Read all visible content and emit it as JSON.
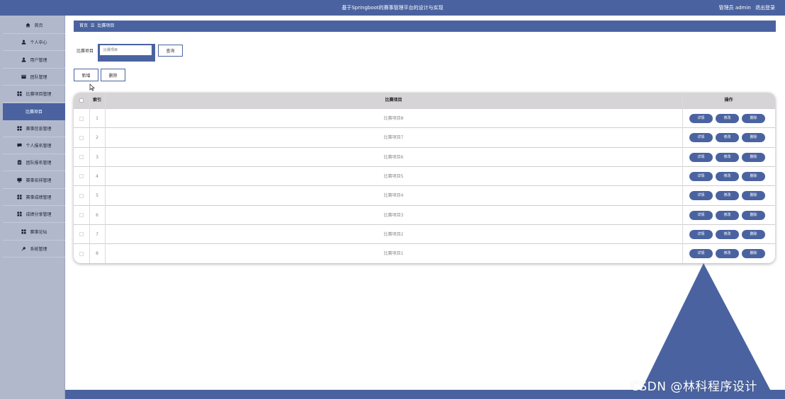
{
  "header": {
    "title": "基于Springboot的赛事管理平台的设计与实现",
    "user_label": "管理员 admin",
    "logout_label": "退出登录"
  },
  "sidebar": {
    "items": [
      {
        "label": "首页",
        "icon": "home-icon"
      },
      {
        "label": "个人中心",
        "icon": "user-icon"
      },
      {
        "label": "用户管理",
        "icon": "user-icon"
      },
      {
        "label": "团队管理",
        "icon": "folder-icon"
      },
      {
        "label": "比赛项目管理",
        "icon": "grid-icon"
      },
      {
        "label": "比赛项目",
        "icon": "",
        "active": true
      },
      {
        "label": "赛事信息管理",
        "icon": "grid-icon"
      },
      {
        "label": "个人报名管理",
        "icon": "comment-icon"
      },
      {
        "label": "团队报名管理",
        "icon": "clipboard-icon"
      },
      {
        "label": "赛事安排管理",
        "icon": "monitor-icon"
      },
      {
        "label": "赛事成绩管理",
        "icon": "grid-icon"
      },
      {
        "label": "成绩分享管理",
        "icon": "grid-icon"
      },
      {
        "label": "赛事论坛",
        "icon": "grid-icon"
      },
      {
        "label": "系统管理",
        "icon": "pin-icon"
      }
    ]
  },
  "breadcrumb": {
    "home": "首页",
    "separator": "☰",
    "current": "比赛项目"
  },
  "search": {
    "label": "比赛项目",
    "placeholder": "比赛项目",
    "query_label": "查询"
  },
  "toolbar": {
    "add_label": "新增",
    "delete_label": "删除"
  },
  "table": {
    "headers": {
      "index": "索引",
      "name": "比赛项目",
      "actions": "操作"
    },
    "action_labels": {
      "detail": "详情",
      "edit": "修改",
      "delete": "删除"
    },
    "rows": [
      {
        "index": "1",
        "name": "比赛项目8"
      },
      {
        "index": "2",
        "name": "比赛项目7"
      },
      {
        "index": "3",
        "name": "比赛项目6"
      },
      {
        "index": "4",
        "name": "比赛项目5"
      },
      {
        "index": "5",
        "name": "比赛项目4"
      },
      {
        "index": "6",
        "name": "比赛项目3"
      },
      {
        "index": "7",
        "name": "比赛项目2"
      },
      {
        "index": "8",
        "name": "比赛项目1"
      }
    ]
  },
  "watermark": "CSDN @林科程序设计",
  "colors": {
    "primary": "#4a63a0",
    "sidebar_bg": "#b2b8cc",
    "table_header_bg": "#d6d4d6"
  }
}
